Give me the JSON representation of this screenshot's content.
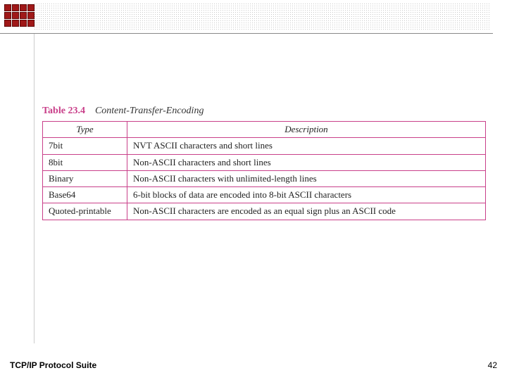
{
  "caption": {
    "label": "Table 23.4",
    "title": "Content-Transfer-Encoding"
  },
  "headers": {
    "type": "Type",
    "description": "Description"
  },
  "rows": [
    {
      "type": "7bit",
      "desc": "NVT ASCII characters and short lines"
    },
    {
      "type": "8bit",
      "desc": "Non-ASCII characters and short lines"
    },
    {
      "type": "Binary",
      "desc": "Non-ASCII characters with unlimited-length lines"
    },
    {
      "type": "Base64",
      "desc": "6-bit blocks of data are encoded into 8-bit ASCII characters"
    },
    {
      "type": "Quoted-printable",
      "desc": "Non-ASCII characters are encoded as an equal sign plus an ASCII code"
    }
  ],
  "footer": {
    "title": "TCP/IP Protocol Suite",
    "page": "42"
  }
}
